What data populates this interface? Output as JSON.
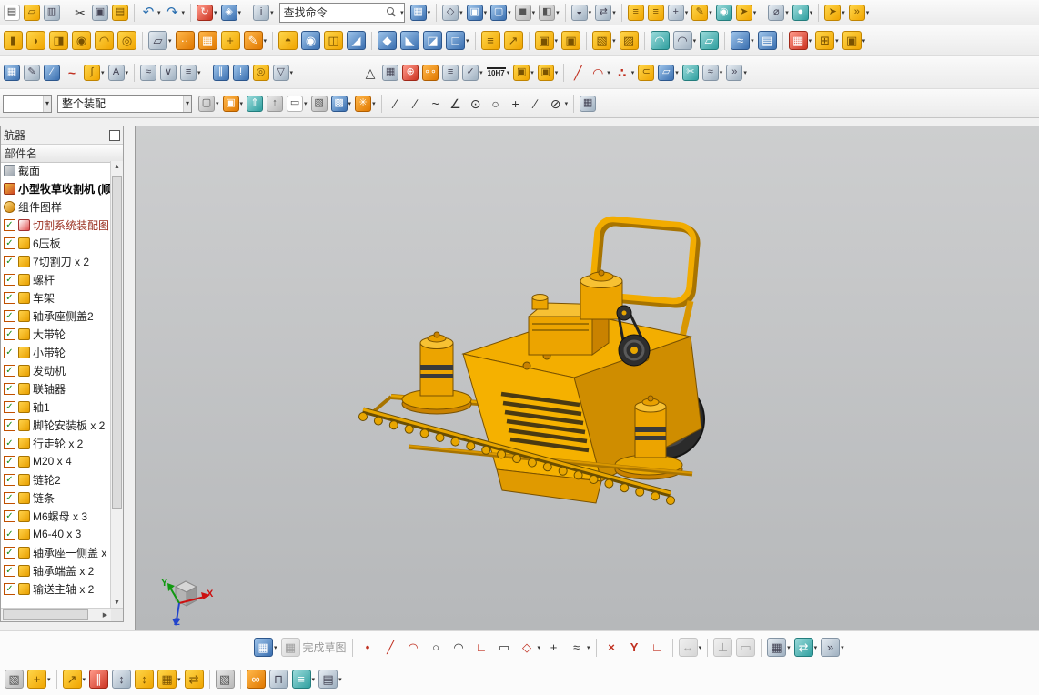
{
  "toolbar": {
    "search": {
      "value": "查找命令"
    },
    "selection_scope": {
      "value": "整个装配"
    },
    "scope_empty": {
      "value": ""
    },
    "rows": {
      "r1a": [
        {
          "n": "new-file",
          "v": "white",
          "g": "▤"
        },
        {
          "n": "open-file",
          "v": "yellow",
          "g": "▱"
        },
        {
          "n": "save",
          "v": "steel",
          "g": "▥"
        },
        {
          "sep": true
        },
        {
          "n": "cut",
          "v": "plain",
          "g": "✂"
        },
        {
          "n": "copy",
          "v": "steel",
          "g": "▣"
        },
        {
          "n": "paste",
          "v": "yellow",
          "g": "▤"
        },
        {
          "sep": true
        },
        {
          "n": "undo",
          "v": "plainblue",
          "g": "↶",
          "dd": true
        },
        {
          "n": "redo",
          "v": "plainblue",
          "g": "↷",
          "dd": true
        },
        {
          "sep": true
        },
        {
          "n": "repeat-command",
          "v": "red",
          "g": "↻",
          "dd": true
        },
        {
          "n": "touch-mode",
          "v": "blue",
          "g": "◈",
          "dd": true
        },
        {
          "sep": true
        },
        {
          "n": "command-finder",
          "v": "steel",
          "g": "i",
          "dd": true
        }
      ],
      "r1b": [
        {
          "n": "window-layout",
          "v": "blue",
          "g": "▦",
          "dd": true
        },
        {
          "sep": true
        },
        {
          "n": "view-orient",
          "v": "steel",
          "g": "◇",
          "dd": true
        },
        {
          "n": "view-section",
          "v": "blue",
          "g": "▣",
          "dd": true
        },
        {
          "n": "fit-view",
          "v": "blue",
          "g": "▢",
          "dd": true
        },
        {
          "n": "render-style",
          "v": "gray",
          "g": "◼",
          "dd": true
        },
        {
          "n": "shaded-view",
          "v": "gray",
          "g": "◧",
          "dd": true
        },
        {
          "sep": true
        },
        {
          "n": "show-hide",
          "v": "steel",
          "g": "◒",
          "dd": true
        },
        {
          "n": "pan-rotate",
          "v": "steel",
          "g": "⇄",
          "dd": true
        },
        {
          "sep": true
        },
        {
          "n": "reuse-library",
          "v": "yellow",
          "g": "≡"
        },
        {
          "n": "part-family",
          "v": "yellow",
          "g": "≡"
        },
        {
          "n": "datum-csys",
          "v": "steel",
          "g": "+",
          "dd": true
        },
        {
          "n": "edit-object",
          "v": "yellow",
          "g": "✎",
          "dd": true
        },
        {
          "n": "object-display",
          "v": "teal",
          "g": "◉"
        },
        {
          "n": "snapshot",
          "v": "yellow",
          "g": "➤",
          "dd": true
        },
        {
          "sep": true
        },
        {
          "n": "measure",
          "v": "steel",
          "g": "⌀",
          "dd": true
        },
        {
          "n": "material",
          "v": "teal",
          "g": "●",
          "dd": true
        },
        {
          "sep": true
        },
        {
          "n": "arrange",
          "v": "yellow",
          "g": "➤",
          "dd": true
        },
        {
          "n": "more-commands",
          "v": "yellow",
          "g": "»",
          "dd": true
        }
      ],
      "r2": [
        {
          "n": "block",
          "v": "yellow",
          "g": "▮"
        },
        {
          "n": "cylinder",
          "v": "yellow",
          "g": "◗"
        },
        {
          "n": "extrude",
          "v": "yellow",
          "g": "◨"
        },
        {
          "n": "revolve",
          "v": "yellow",
          "g": "◉"
        },
        {
          "n": "sweep",
          "v": "yellow",
          "g": "◠"
        },
        {
          "n": "tube",
          "v": "yellow",
          "g": "◎"
        },
        {
          "sep": true
        },
        {
          "n": "datum-plane",
          "v": "steel",
          "g": "▱",
          "dd": true
        },
        {
          "n": "point-set",
          "v": "orange",
          "g": "··"
        },
        {
          "n": "pattern-feature",
          "v": "orange",
          "g": "▦"
        },
        {
          "n": "unite",
          "v": "yellow",
          "g": "+"
        },
        {
          "n": "sketch",
          "v": "orange",
          "g": "✎",
          "dd": true
        },
        {
          "sep": true
        },
        {
          "n": "boss",
          "v": "yellow",
          "g": "◓"
        },
        {
          "n": "hole",
          "v": "blue",
          "g": "◉"
        },
        {
          "n": "rib",
          "v": "yellow",
          "g": "◫"
        },
        {
          "n": "draft",
          "v": "blue",
          "g": "◢"
        },
        {
          "sep": true
        },
        {
          "n": "edge-blend",
          "v": "blue",
          "g": "◆"
        },
        {
          "n": "chamfer",
          "v": "blue",
          "g": "◣"
        },
        {
          "n": "trim-body",
          "v": "blue",
          "g": "◪"
        },
        {
          "n": "shell",
          "v": "blue",
          "g": "□",
          "dd": true
        },
        {
          "sep": true
        },
        {
          "n": "offset-face",
          "v": "yellow",
          "g": "≡"
        },
        {
          "n": "scale-body",
          "v": "yellow",
          "g": "↗"
        },
        {
          "sep": true
        },
        {
          "n": "more-feature",
          "v": "yellow",
          "g": "▣",
          "dd": true
        },
        {
          "n": "assoc-copy",
          "v": "yellow",
          "g": "▣"
        },
        {
          "sep": true
        },
        {
          "n": "sync-move-face",
          "v": "yellow",
          "g": "▧",
          "dd": true
        },
        {
          "n": "sync-pull-face",
          "v": "yellow",
          "g": "▨"
        },
        {
          "sep": true
        },
        {
          "n": "through-curves",
          "v": "teal",
          "g": "◠"
        },
        {
          "n": "swept",
          "v": "steel",
          "g": "◠",
          "dd": true
        },
        {
          "n": "fill-surface",
          "v": "teal",
          "g": "▱"
        },
        {
          "sep": true
        },
        {
          "n": "sew",
          "v": "blue",
          "g": "≈",
          "dd": true
        },
        {
          "n": "patch",
          "v": "blue",
          "g": "▤"
        },
        {
          "sep": true
        },
        {
          "n": "pattern-face",
          "v": "red",
          "g": "▦",
          "dd": true
        },
        {
          "n": "combine",
          "v": "yellow",
          "g": "⊞",
          "dd": true
        },
        {
          "n": "more-shape",
          "v": "yellow",
          "g": "▣",
          "dd": true
        }
      ],
      "r3": [
        {
          "n": "sketch-grid",
          "v": "blue",
          "g": "▦"
        },
        {
          "n": "annotation",
          "v": "steel",
          "g": "✎"
        },
        {
          "n": "datum-axis",
          "v": "blue",
          "g": "∕"
        },
        {
          "n": "studio-spline",
          "v": "plainred",
          "g": "~"
        },
        {
          "n": "law-curve",
          "v": "yellow",
          "g": "∫",
          "dd": true
        },
        {
          "n": "text-tool",
          "v": "steel",
          "g": "A",
          "dd": true
        },
        {
          "sep": true
        },
        {
          "n": "curve-analysis",
          "v": "steel",
          "g": "≈"
        },
        {
          "n": "deviation-gauge",
          "v": "steel",
          "g": "∨"
        },
        {
          "n": "info-list",
          "v": "steel",
          "g": "≡",
          "dd": true
        },
        {
          "sep": true
        },
        {
          "n": "histogram",
          "v": "blue",
          "g": "∥"
        },
        {
          "n": "pin",
          "v": "blue",
          "g": "!"
        },
        {
          "n": "torus",
          "v": "yellow",
          "g": "◎"
        },
        {
          "n": "filter",
          "v": "steel",
          "g": "▽",
          "dd": true
        },
        {
          "sp": 70
        },
        {
          "n": "triangle-tool",
          "v": "plain",
          "g": "△"
        },
        {
          "n": "table-tool",
          "v": "steel",
          "g": "▦"
        },
        {
          "n": "target-point",
          "v": "red",
          "g": "⊕"
        },
        {
          "n": "ball-group",
          "v": "orange",
          "g": "∘∘"
        },
        {
          "n": "note-list",
          "v": "steel",
          "g": "≡"
        },
        {
          "n": "check-mate",
          "v": "steel",
          "g": "✓",
          "dd": true
        },
        {
          "n": "tolerance-10h7",
          "v": "tol",
          "g": "10H7",
          "dd": true
        },
        {
          "n": "pair-solids",
          "v": "yellow",
          "g": "▣",
          "dd": true
        },
        {
          "n": "pair-solids-2",
          "v": "yellow",
          "g": "▣",
          "dd": true
        },
        {
          "sep": true
        },
        {
          "n": "line-tool",
          "v": "plainred",
          "g": "╱"
        },
        {
          "n": "arc-points",
          "v": "plainred",
          "g": "◠",
          "dd": true
        },
        {
          "n": "point-cloud",
          "v": "plainred",
          "g": "∴",
          "dd": true
        },
        {
          "n": "planar-curve",
          "v": "yellow",
          "g": "⊂"
        },
        {
          "n": "surface-curve",
          "v": "blue",
          "g": "▱",
          "dd": true
        },
        {
          "n": "trim-curve",
          "v": "teal",
          "g": "✂"
        },
        {
          "n": "offset-curve",
          "v": "steel",
          "g": "≈",
          "dd": true
        },
        {
          "n": "more-curve",
          "v": "steel",
          "g": "»",
          "dd": true
        }
      ],
      "r4": [
        {
          "n": "selection-filter",
          "v": "gray",
          "g": "▢",
          "dd": true
        },
        {
          "n": "snap-point-options",
          "v": "orange",
          "g": "▣",
          "dd": true
        },
        {
          "n": "select-top",
          "v": "teal",
          "g": "⇑"
        },
        {
          "n": "select-parent",
          "v": "gray",
          "g": "↑"
        },
        {
          "n": "marquee-select",
          "v": "white",
          "g": "▭",
          "dd": true
        },
        {
          "n": "general-object",
          "v": "gray",
          "g": "▧"
        },
        {
          "n": "shaded-object",
          "v": "blue",
          "g": "▩",
          "dd": true
        },
        {
          "n": "highlight",
          "v": "orange",
          "g": "✳",
          "dd": true
        },
        {
          "sep": true
        },
        {
          "n": "snap-endpoint",
          "v": "plain",
          "g": "∕"
        },
        {
          "n": "snap-midpoint",
          "v": "plain",
          "g": "∕"
        },
        {
          "n": "snap-curve",
          "v": "plain",
          "g": "~"
        },
        {
          "n": "snap-angle",
          "v": "plain",
          "g": "∠"
        },
        {
          "n": "snap-center",
          "v": "plain",
          "g": "⊙"
        },
        {
          "n": "snap-circle",
          "v": "plain",
          "g": "○"
        },
        {
          "n": "snap-point",
          "v": "plain",
          "g": "+"
        },
        {
          "n": "snap-intersection",
          "v": "plain",
          "g": "∕"
        },
        {
          "n": "snap-disable",
          "v": "plain",
          "g": "⊘",
          "dd": true
        },
        {
          "sep": true
        },
        {
          "n": "grid-snap",
          "v": "steel",
          "g": "▦"
        }
      ],
      "b1": [
        {
          "n": "task-sketch",
          "v": "blue",
          "g": "▦",
          "dd": true
        },
        {
          "n": "finish-sketch",
          "v": "gray",
          "g": "▦",
          "t": "完成草图",
          "dis": true
        },
        {
          "sep": true
        },
        {
          "n": "sketch-point",
          "v": "plainred",
          "g": "•"
        },
        {
          "n": "profile",
          "v": "plainred",
          "g": "╱"
        },
        {
          "n": "arc",
          "v": "plainred",
          "g": "◠"
        },
        {
          "n": "circle",
          "v": "plain",
          "g": "○"
        },
        {
          "n": "arc-3pt",
          "v": "plain",
          "g": "◠"
        },
        {
          "n": "fillet-sketch",
          "v": "plainred",
          "g": "∟"
        },
        {
          "n": "rectangle",
          "v": "plain",
          "g": "▭"
        },
        {
          "n": "polygon",
          "v": "plainred",
          "g": "◇",
          "dd": true
        },
        {
          "n": "point-plus",
          "v": "plain",
          "g": "+"
        },
        {
          "n": "offset-sketch-curve",
          "v": "plain",
          "g": "≈",
          "dd": true
        },
        {
          "sep": true
        },
        {
          "n": "quick-trim",
          "v": "plainred",
          "g": "×"
        },
        {
          "n": "quick-extend",
          "v": "plainred",
          "g": "Y"
        },
        {
          "n": "make-corner",
          "v": "plainred",
          "g": "∟"
        },
        {
          "sep": true
        },
        {
          "n": "rapid-dimension",
          "v": "gray",
          "g": "↔",
          "dis": true,
          "dd": true
        },
        {
          "sep": true
        },
        {
          "n": "geometric-constraints",
          "v": "gray",
          "g": "⊥",
          "dis": true
        },
        {
          "n": "auto-constrain",
          "v": "gray",
          "g": "▭",
          "dis": true
        },
        {
          "sep": true
        },
        {
          "n": "pattern-curve",
          "v": "steel",
          "g": "▦",
          "dd": true
        },
        {
          "n": "mirror-curve",
          "v": "teal",
          "g": "⇄",
          "dd": true
        },
        {
          "n": "sketch-more",
          "v": "steel",
          "g": "»",
          "dd": true
        }
      ],
      "b2": [
        {
          "n": "window-box",
          "v": "gray",
          "g": "▧"
        },
        {
          "n": "add-component",
          "v": "yellow",
          "g": "+",
          "dd": true
        },
        {
          "sep": true
        },
        {
          "n": "move-component",
          "v": "yellow",
          "g": "↗",
          "dd": true
        },
        {
          "n": "assembly-constraints",
          "v": "red",
          "g": "∥"
        },
        {
          "n": "show-dof",
          "v": "steel",
          "g": "↕"
        },
        {
          "n": "exploded-view",
          "v": "yellow",
          "g": "↕"
        },
        {
          "n": "pattern-component",
          "v": "yellow",
          "g": "▦",
          "dd": true
        },
        {
          "n": "mirror-assembly",
          "v": "yellow",
          "g": "⇄"
        },
        {
          "sep": true
        },
        {
          "n": "isometric-box",
          "v": "gray",
          "g": "▧"
        },
        {
          "sep": true
        },
        {
          "n": "chain-link",
          "v": "orange",
          "g": "∞"
        },
        {
          "n": "clamp",
          "v": "steel",
          "g": "⊓"
        },
        {
          "n": "wave-link",
          "v": "teal",
          "g": "≡",
          "dd": true
        },
        {
          "n": "interpart",
          "v": "steel",
          "g": "▤",
          "dd": true
        }
      ]
    }
  },
  "navigator": {
    "title": "航器",
    "column_header": "部件名",
    "check_glyph": "✓",
    "items": [
      {
        "label": "截面",
        "in": "section-icon",
        "iv": "graysec"
      },
      {
        "label": "小型牧草收割机 (顺",
        "in": "assembly-root-icon",
        "iv": "rootred",
        "bold": true
      },
      {
        "label": "组件图样",
        "in": "drawing-icon",
        "iv": "gearorange"
      },
      {
        "label": "切割系统装配图",
        "in": "subassembly-icon",
        "iv": "drawred",
        "check": true,
        "red": true
      },
      {
        "label": "6压板",
        "in": "part-icon",
        "iv": "part",
        "check": true
      },
      {
        "label": "7切割刀 x 2",
        "in": "part-icon",
        "iv": "part",
        "check": true
      },
      {
        "label": "螺杆",
        "in": "part-icon",
        "iv": "part",
        "check": true
      },
      {
        "label": "车架",
        "in": "part-icon",
        "iv": "part",
        "check": true
      },
      {
        "label": "轴承座侧盖2",
        "in": "part-icon",
        "iv": "part",
        "check": true
      },
      {
        "label": "大带轮",
        "in": "part-icon",
        "iv": "part",
        "check": true
      },
      {
        "label": "小带轮",
        "in": "part-icon",
        "iv": "part",
        "check": true
      },
      {
        "label": "发动机",
        "in": "part-icon",
        "iv": "part",
        "check": true
      },
      {
        "label": "联轴器",
        "in": "part-icon",
        "iv": "part",
        "check": true
      },
      {
        "label": "轴1",
        "in": "part-icon",
        "iv": "part",
        "check": true
      },
      {
        "label": "脚轮安装板 x 2",
        "in": "part-icon",
        "iv": "part",
        "check": true
      },
      {
        "label": "行走轮 x 2",
        "in": "part-icon",
        "iv": "part",
        "check": true
      },
      {
        "label": "M20 x 4",
        "in": "part-icon",
        "iv": "part",
        "check": true
      },
      {
        "label": "链轮2",
        "in": "part-icon",
        "iv": "part",
        "check": true
      },
      {
        "label": "链条",
        "in": "part-icon",
        "iv": "part",
        "check": true
      },
      {
        "label": "M6螺母 x 3",
        "in": "part-icon",
        "iv": "part",
        "check": true
      },
      {
        "label": "M6-40 x 3",
        "in": "part-icon",
        "iv": "part",
        "check": true
      },
      {
        "label": "轴承座一侧盖 x",
        "in": "part-icon",
        "iv": "part",
        "check": true
      },
      {
        "label": "轴承端盖 x 2",
        "in": "part-icon",
        "iv": "part",
        "check": true
      },
      {
        "label": "输送主轴 x 2",
        "in": "part-icon",
        "iv": "part",
        "check": true
      }
    ]
  },
  "viewport": {
    "triad": {
      "x": "X",
      "y": "Y",
      "z": "Z"
    },
    "colors": {
      "machine_yellow": "#F0A800",
      "machine_dark": "#C98200",
      "machine_outline": "#7A5200",
      "wheel": "#2B2B2B",
      "background_top": "#CDCECF",
      "background_bottom": "#B6B8BA"
    }
  }
}
